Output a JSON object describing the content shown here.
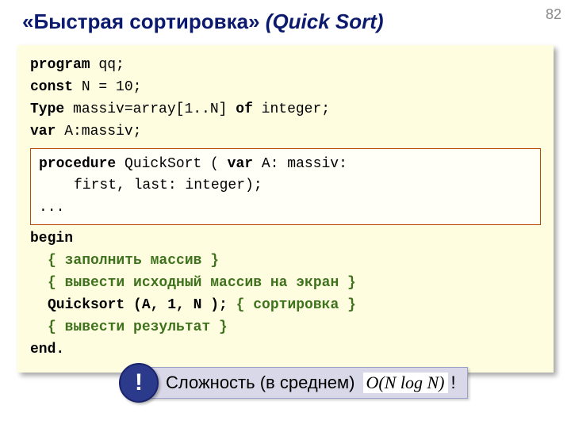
{
  "slide_number": "82",
  "title_main": "«Быстрая сортировка»",
  "title_italic": "(Quick Sort)",
  "code": {
    "l1_a": "program",
    "l1_b": " qq;",
    "l2_a": "const",
    "l2_b": " N = 10;",
    "l3_a": "Type",
    "l3_b": " massiv=array[1..N] ",
    "l3_c": "of",
    "l3_d": " integer;",
    "l4_a": "var",
    "l4_b": " A:massiv;",
    "proc1_a": "procedure",
    "proc1_b": " QuickSort ( ",
    "proc1_c": "var",
    "proc1_d": " A: massiv:",
    "proc2": "first, last: integer);",
    "proc3": "...",
    "l5": "begin",
    "c1": "{ заполнить массив }",
    "c2": "{ вывести исходный массив на экран }",
    "call_a": "Quicksort (A, 1, N );",
    "call_b": " { сортировка }",
    "c3": "{ вывести результат }",
    "l6": "end."
  },
  "callout": {
    "bang": "!",
    "label": "Сложность (в среднем)",
    "formula": "O(N log N)",
    "trail": "!"
  }
}
